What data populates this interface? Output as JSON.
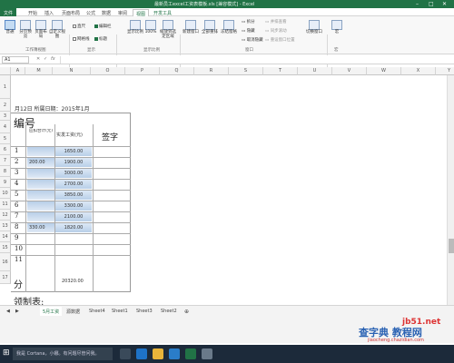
{
  "window": {
    "title": "最新员工excel工资表模板.xls [兼容模式] - Excel"
  },
  "ribbon_tabs": [
    "文件",
    "开始",
    "插入",
    "页面布局",
    "公式",
    "数据",
    "审阅",
    "视图",
    "开发工具"
  ],
  "ribbon": {
    "normal": "普通",
    "page_break": "分页预览",
    "page_layout": "页面布局",
    "custom_view": "自定义视图",
    "ruler": "直尺",
    "formula_bar": "编辑栏",
    "gridlines": "网格线",
    "headings": "标题",
    "zoom": "显示比例",
    "zoom100": "100%",
    "zoom_sel": "缩放到选定区域",
    "new_window": "新建窗口",
    "arrange_all": "全部重排",
    "freeze": "冻结窗格",
    "split": "拆分",
    "hide": "隐藏",
    "unhide": "取消隐藏",
    "side_by_side": "并排查看",
    "sync_scroll": "同步滚动",
    "reset_pos": "重设窗口位置",
    "switch_window": "切换窗口",
    "macros": "宏",
    "groups": [
      "工作簿视图",
      "显示",
      "显示比例",
      "窗口",
      "宏"
    ]
  },
  "formula_bar": {
    "name_box": "A1",
    "fx": "fx"
  },
  "columns": [
    "A",
    "M",
    "N",
    "O",
    "P",
    "Q",
    "R",
    "S",
    "T",
    "U",
    "V",
    "W",
    "X",
    "Y"
  ],
  "rows": [
    "1",
    "2",
    "3",
    "4",
    "5",
    "6",
    "7",
    "8",
    "9",
    "10",
    "11",
    "12",
    "13",
    "14",
    "15",
    "16",
    "17"
  ],
  "sheet": {
    "date_text": "月12日  所属日期：2015年1月",
    "hdr_bian": "编号",
    "hdr_m": "应扣合计(元)",
    "hdr_n": "实发工资(元)",
    "hdr_sign": "签字",
    "ids": [
      "1",
      "2",
      "3",
      "4",
      "5",
      "6",
      "7",
      "8",
      "9",
      "10",
      "11"
    ],
    "m_vals": [
      "",
      "200.00",
      "",
      "",
      "",
      "",
      "",
      "330.00"
    ],
    "n_vals": [
      "1650.00",
      "1900.00",
      "3000.00",
      "2700.00",
      "3850.00",
      "3300.00",
      "2100.00",
      "1820.00"
    ],
    "total_label": "分",
    "total": "20320.00",
    "footer": "领制表:"
  },
  "sheet_tabs": [
    "5月工资",
    "源数据",
    "Sheet4",
    "Sheet1",
    "Sheet3",
    "Sheet2"
  ],
  "taskbar": {
    "search": "我是 Cortana，小娜。有问题尽管问我。"
  },
  "watermark": {
    "brand": "查字典 教程网",
    "url": "jiaocheng.chazidian.com",
    "site": "jb51.net"
  }
}
